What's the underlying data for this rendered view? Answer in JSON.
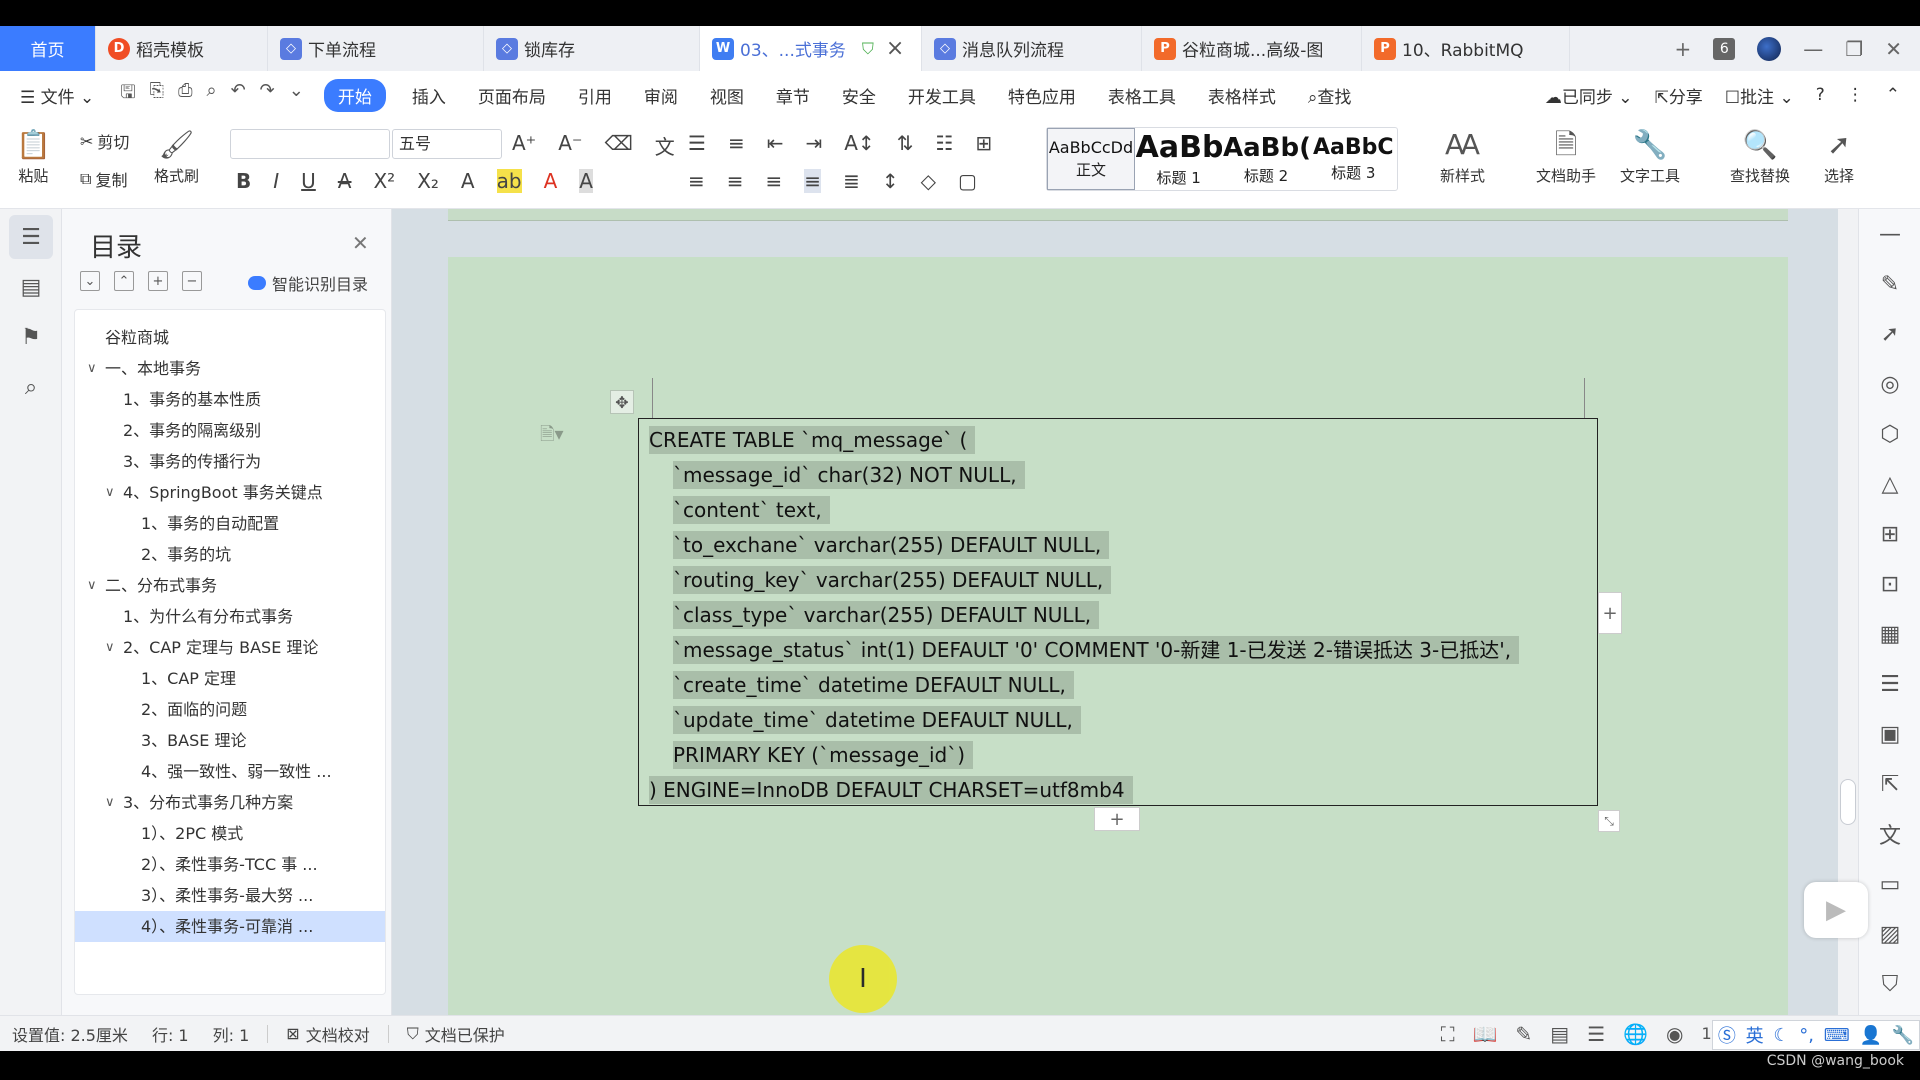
{
  "tabs": [
    {
      "label": "首页",
      "icon": "",
      "kind": "home"
    },
    {
      "label": "稻壳模板",
      "icon": "docer-icon",
      "kind": "s"
    },
    {
      "label": "下单流程",
      "icon": "diagram-icon",
      "kind": "d"
    },
    {
      "label": "锁库存",
      "icon": "diagram-icon",
      "kind": "d"
    },
    {
      "label": "03、...式事务",
      "icon": "writer-icon",
      "kind": "w",
      "active": true
    },
    {
      "label": "消息队列流程",
      "icon": "diagram-icon",
      "kind": "d"
    },
    {
      "label": "谷粒商城...高级-图",
      "icon": "presentation-icon",
      "kind": "p"
    },
    {
      "label": "10、RabbitMQ",
      "icon": "presentation-icon",
      "kind": "p"
    }
  ],
  "tabbar": {
    "new_tab": "+",
    "tab_count": "6"
  },
  "menu": {
    "file": "文件",
    "items": [
      "开始",
      "插入",
      "页面布局",
      "引用",
      "审阅",
      "视图",
      "章节",
      "安全",
      "开发工具",
      "特色应用",
      "表格工具",
      "表格样式"
    ],
    "search": "查找",
    "synced": "已同步",
    "share": "分享",
    "comment": "批注"
  },
  "ribbon": {
    "paste": "粘贴",
    "cut": "剪切",
    "copy": "复制",
    "format_painter": "格式刷",
    "font_name": "",
    "font_size": "五号",
    "styles": [
      {
        "sample": "AaBbCcDd",
        "name": "正文"
      },
      {
        "sample": "AaBb",
        "name": "标题 1"
      },
      {
        "sample": "AaBb(",
        "name": "标题 2"
      },
      {
        "sample": "AaBbC",
        "name": "标题 3"
      }
    ],
    "new_style": "新样式",
    "doc_assistant": "文档助手",
    "text_tools": "文字工具",
    "find_replace": "查找替换",
    "select": "选择"
  },
  "toc": {
    "title": "目录",
    "smart": "智能识别目录",
    "items": [
      {
        "label": "谷粒商城",
        "level": 0,
        "arrow": ""
      },
      {
        "label": "一、本地事务",
        "level": 0,
        "arrow": "v"
      },
      {
        "label": "1、事务的基本性质",
        "level": 1,
        "arrow": ""
      },
      {
        "label": "2、事务的隔离级别",
        "level": 1,
        "arrow": ""
      },
      {
        "label": "3、事务的传播行为",
        "level": 1,
        "arrow": ""
      },
      {
        "label": "4、SpringBoot 事务关键点",
        "level": 1,
        "arrow": "v"
      },
      {
        "label": "1、事务的自动配置",
        "level": 2,
        "arrow": ""
      },
      {
        "label": "2、事务的坑",
        "level": 2,
        "arrow": ""
      },
      {
        "label": "二、分布式事务",
        "level": 0,
        "arrow": "v"
      },
      {
        "label": "1、为什么有分布式事务",
        "level": 1,
        "arrow": ""
      },
      {
        "label": "2、CAP 定理与 BASE 理论",
        "level": 1,
        "arrow": "v"
      },
      {
        "label": "1、CAP 定理",
        "level": 2,
        "arrow": ""
      },
      {
        "label": "2、面临的问题",
        "level": 2,
        "arrow": ""
      },
      {
        "label": "3、BASE 理论",
        "level": 2,
        "arrow": ""
      },
      {
        "label": "4、强一致性、弱一致性 ...",
        "level": 2,
        "arrow": ""
      },
      {
        "label": "3、分布式事务几种方案",
        "level": 1,
        "arrow": "v"
      },
      {
        "label": "1）、2PC 模式",
        "level": 2,
        "arrow": ""
      },
      {
        "label": "2）、柔性事务-TCC 事 ...",
        "level": 2,
        "arrow": ""
      },
      {
        "label": "3）、柔性事务-最大努 ...",
        "level": 2,
        "arrow": ""
      },
      {
        "label": "4）、柔性事务-可靠消 ...",
        "level": 2,
        "arrow": "",
        "selected": true
      }
    ]
  },
  "document": {
    "code_lines": [
      {
        "text": "CREATE TABLE `mq_message` (",
        "indent": false
      },
      {
        "text": "`message_id` char(32) NOT NULL,",
        "indent": true
      },
      {
        "text": "`content` text,",
        "indent": true
      },
      {
        "text": "`to_exchane` varchar(255) DEFAULT NULL,",
        "indent": true
      },
      {
        "text": "`routing_key` varchar(255) DEFAULT NULL,",
        "indent": true
      },
      {
        "text": "`class_type` varchar(255) DEFAULT NULL,",
        "indent": true
      },
      {
        "text": "`message_status` int(1) DEFAULT '0' COMMENT '0-新建  1-已发送  2-错误抵达  3-已抵达',",
        "indent": true
      },
      {
        "text": "`create_time` datetime DEFAULT NULL,",
        "indent": true
      },
      {
        "text": "`update_time` datetime DEFAULT NULL,",
        "indent": true
      },
      {
        "text": "PRIMARY KEY (`message_id`)",
        "indent": true
      },
      {
        "text": ") ENGINE=InnoDB DEFAULT CHARSET=utf8mb4",
        "indent": false
      }
    ]
  },
  "status": {
    "setting": "设置值: 2.5厘米",
    "row": "行: 1",
    "col": "列: 1",
    "proofread": "文档校对",
    "protected": "文档已保护",
    "zoom": "120%"
  },
  "ime": {
    "lang": "英"
  },
  "watermark": "CSDN @wang_book",
  "colors": {
    "accent": "#3b7cff",
    "page_bg": "#c7dfc7",
    "highlight": "#a9bea9"
  }
}
